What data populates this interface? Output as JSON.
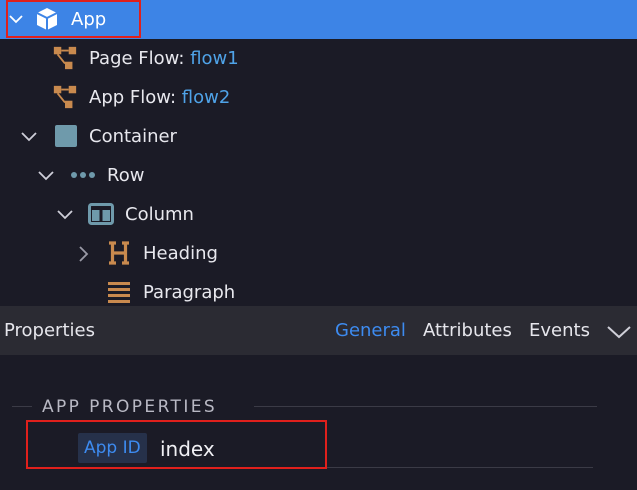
{
  "tree": {
    "items": [
      {
        "label": "App",
        "icon": "cube-icon",
        "expanded": true,
        "selected": true
      },
      {
        "label_prefix": "Page Flow: ",
        "label_value": "flow1",
        "icon": "flow-icon"
      },
      {
        "label_prefix": "App Flow: ",
        "label_value": "flow2",
        "icon": "flow-icon"
      },
      {
        "label": "Container",
        "icon": "container-icon",
        "expanded": true
      },
      {
        "label": "Row",
        "icon": "row-dots-icon",
        "expanded": true
      },
      {
        "label": "Column",
        "icon": "column-icon",
        "expanded": true
      },
      {
        "label": "Heading",
        "icon": "heading-icon",
        "expanded": false
      },
      {
        "label": "Paragraph",
        "icon": "paragraph-icon"
      }
    ]
  },
  "properties": {
    "title": "Properties",
    "tabs": [
      "General",
      "Attributes",
      "Events"
    ],
    "active_tab": "General",
    "section_title": "APP PROPERTIES",
    "app_id_label": "App ID",
    "app_id_value": "index"
  },
  "colors": {
    "selected_row": "#3d84e6",
    "accent": "#3d8bf0",
    "flow_value": "#4fa3e8",
    "icon_orange": "#c98a4e",
    "icon_teal": "#6f9aab",
    "highlight_outline": "#e0201c"
  }
}
